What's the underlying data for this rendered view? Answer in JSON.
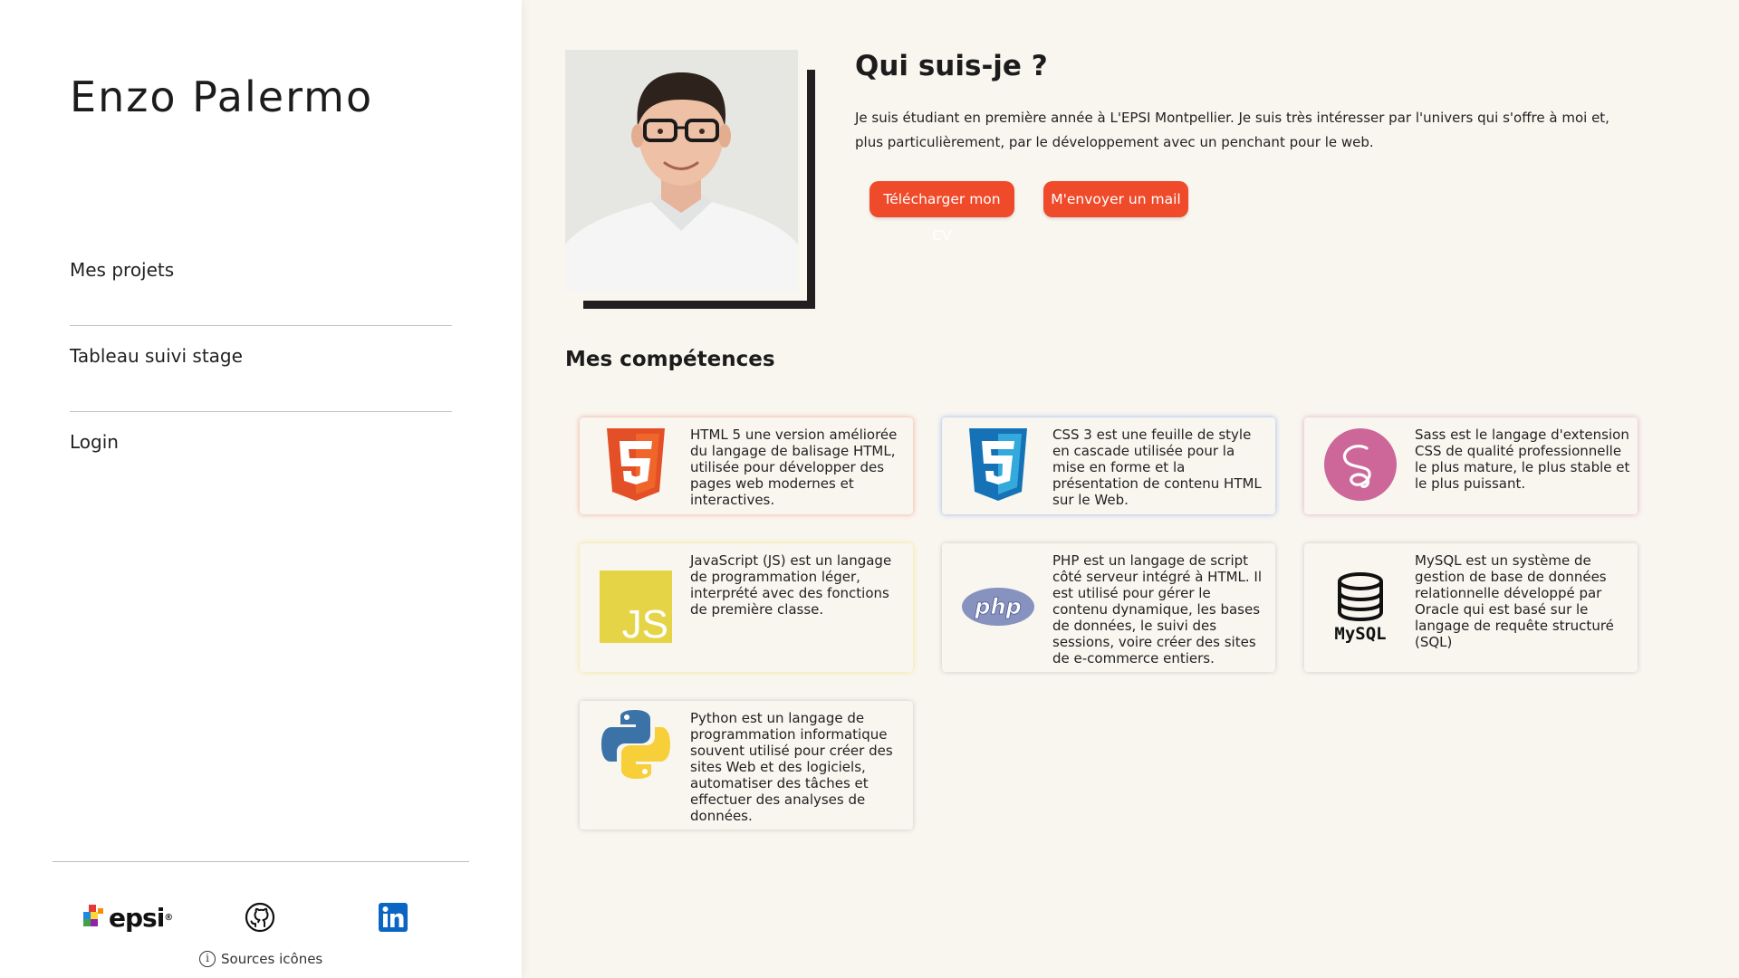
{
  "sidebar": {
    "name": "Enzo Palermo",
    "nav": [
      {
        "label": "Mes projets"
      },
      {
        "label": "Tableau suivi stage"
      },
      {
        "label": "Login"
      }
    ],
    "footer": {
      "epsi_label": "epsi",
      "epsi_reg": "®",
      "sources_label": "Sources icônes"
    }
  },
  "about": {
    "title": "Qui suis-je ?",
    "text": "Je suis étudiant en première année à L'EPSI Montpellier. Je suis très intéresser par l'univers qui s'offre à moi et, plus particulièrement, par le développement avec un penchant pour le web.",
    "btn_cv": "Télécharger mon CV",
    "btn_mail": "M'envoyer un mail"
  },
  "skills": {
    "title": "Mes compétences",
    "items": [
      {
        "icon": "html5-icon",
        "text": "HTML 5 une version améliorée du langage de balisage HTML, utilisée pour développer des pages web modernes et interactives."
      },
      {
        "icon": "css3-icon",
        "text": "CSS 3 est une feuille de style en cascade utilisée pour la mise en forme et la présentation de contenu HTML sur le Web."
      },
      {
        "icon": "sass-icon",
        "text": "Sass est le langage d'extension CSS de qualité professionnelle le plus mature, le plus stable et le plus puissant."
      },
      {
        "icon": "javascript-icon",
        "text": "JavaScript (JS) est un langage de programmation léger, interprété avec des fonctions de première classe."
      },
      {
        "icon": "php-icon",
        "text": "PHP est un langage de script côté serveur intégré à HTML. Il est utilisé pour gérer le contenu dynamique, les bases de données, le suivi des sessions, voire créer des sites de e-commerce entiers."
      },
      {
        "icon": "mysql-icon",
        "text": "MySQL est un système de gestion de base de données relationnelle développé par Oracle qui est basé sur le langage de requête structuré (SQL)"
      },
      {
        "icon": "python-icon",
        "text": "Python est un langage de programmation informatique souvent utilisé pour créer des sites Web et des logiciels, automatiser des tâches et effectuer des analyses de données."
      }
    ],
    "logo_text": {
      "js": "JS",
      "php": "php",
      "mysql": "MySQL"
    }
  },
  "colors": {
    "accent": "#ef4a2a",
    "background": "#f8f6ef",
    "sidebar": "#ffffff"
  }
}
